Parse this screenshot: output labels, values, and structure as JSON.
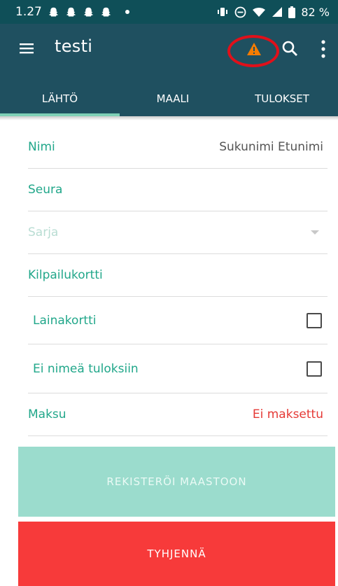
{
  "statusbar": {
    "time": "1.27",
    "battery": "82 %"
  },
  "appbar": {
    "title": "testi",
    "icons": [
      "menu-icon",
      "warning-icon",
      "search-icon",
      "more-vert-icon"
    ],
    "warning_color": "#f57c00"
  },
  "tabs": [
    {
      "label": "LÄHTÖ",
      "active": true
    },
    {
      "label": "MAALI",
      "active": false
    },
    {
      "label": "TULOKSET",
      "active": false
    }
  ],
  "form": {
    "name_label": "Nimi",
    "name_placeholder": "Sukunimi Etunimi",
    "club_label": "Seura",
    "class_label": "Sarja",
    "card_label": "Kilpailukortti",
    "rental_card_label": "Lainakortti",
    "rental_card_checked": false,
    "no_name_label": "Ei nimeä tuloksiin",
    "no_name_checked": false,
    "payment_label": "Maksu",
    "payment_value": "Ei maksettu"
  },
  "buttons": {
    "register": "REKISTERÖI MAASTOON",
    "clear": "TYHJENNÄ"
  },
  "colors": {
    "primary": "#1f5060",
    "accent": "#21a78a",
    "danger": "#f73a3a",
    "register_disabled": "#9bdccd"
  }
}
